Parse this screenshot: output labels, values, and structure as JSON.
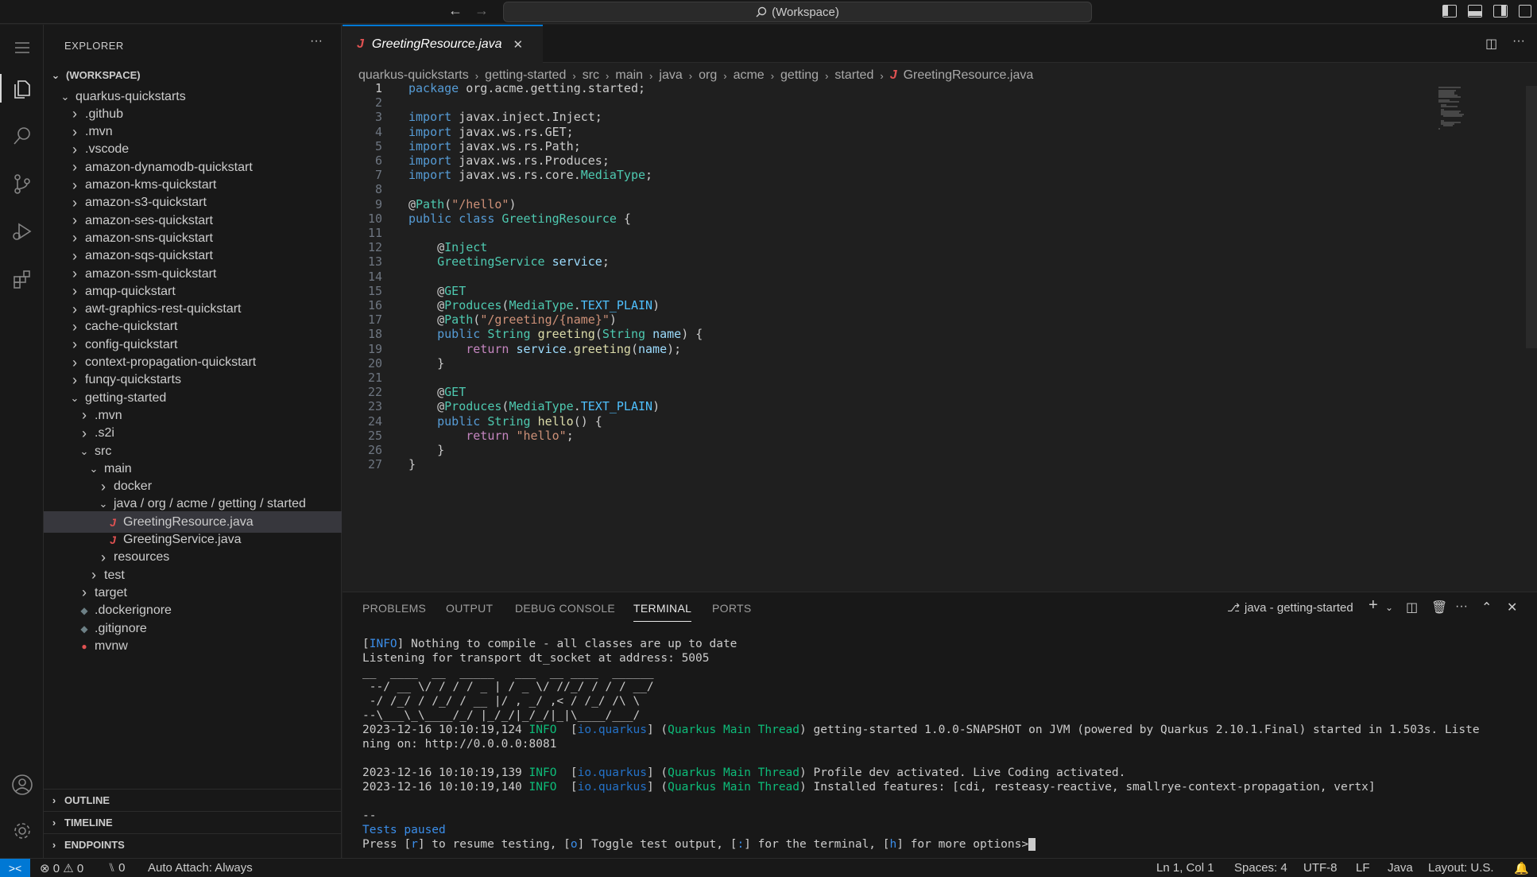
{
  "titlebar": {
    "search": "(Workspace)",
    "back_icon": "arrow-left-icon",
    "forward_icon": "arrow-right-icon"
  },
  "sidebar": {
    "title": "EXPLORER",
    "more": "···",
    "workspace": "(WORKSPACE)",
    "tree": [
      {
        "label": "quarkus-quickstarts",
        "depth": 1,
        "kind": "folder-open"
      },
      {
        "label": ".github",
        "depth": 2,
        "kind": "folder"
      },
      {
        "label": ".mvn",
        "depth": 2,
        "kind": "folder"
      },
      {
        "label": ".vscode",
        "depth": 2,
        "kind": "folder"
      },
      {
        "label": "amazon-dynamodb-quickstart",
        "depth": 2,
        "kind": "folder"
      },
      {
        "label": "amazon-kms-quickstart",
        "depth": 2,
        "kind": "folder"
      },
      {
        "label": "amazon-s3-quickstart",
        "depth": 2,
        "kind": "folder"
      },
      {
        "label": "amazon-ses-quickstart",
        "depth": 2,
        "kind": "folder"
      },
      {
        "label": "amazon-sns-quickstart",
        "depth": 2,
        "kind": "folder"
      },
      {
        "label": "amazon-sqs-quickstart",
        "depth": 2,
        "kind": "folder"
      },
      {
        "label": "amazon-ssm-quickstart",
        "depth": 2,
        "kind": "folder"
      },
      {
        "label": "amqp-quickstart",
        "depth": 2,
        "kind": "folder"
      },
      {
        "label": "awt-graphics-rest-quickstart",
        "depth": 2,
        "kind": "folder"
      },
      {
        "label": "cache-quickstart",
        "depth": 2,
        "kind": "folder"
      },
      {
        "label": "config-quickstart",
        "depth": 2,
        "kind": "folder"
      },
      {
        "label": "context-propagation-quickstart",
        "depth": 2,
        "kind": "folder"
      },
      {
        "label": "funqy-quickstarts",
        "depth": 2,
        "kind": "folder"
      },
      {
        "label": "getting-started",
        "depth": 2,
        "kind": "folder-open"
      },
      {
        "label": ".mvn",
        "depth": 3,
        "kind": "folder"
      },
      {
        "label": ".s2i",
        "depth": 3,
        "kind": "folder"
      },
      {
        "label": "src",
        "depth": 3,
        "kind": "folder-open"
      },
      {
        "label": "main",
        "depth": 4,
        "kind": "folder-open"
      },
      {
        "label": "docker",
        "depth": 5,
        "kind": "folder"
      },
      {
        "label": "java / org / acme / getting / started",
        "depth": 5,
        "kind": "folder-open"
      },
      {
        "label": "GreetingResource.java",
        "depth": 6,
        "kind": "java",
        "selected": true
      },
      {
        "label": "GreetingService.java",
        "depth": 6,
        "kind": "java"
      },
      {
        "label": "resources",
        "depth": 5,
        "kind": "folder"
      },
      {
        "label": "test",
        "depth": 4,
        "kind": "folder"
      },
      {
        "label": "target",
        "depth": 3,
        "kind": "folder"
      },
      {
        "label": ".dockerignore",
        "depth": 3,
        "kind": "dot"
      },
      {
        "label": ".gitignore",
        "depth": 3,
        "kind": "dot"
      },
      {
        "label": "mvnw",
        "depth": 3,
        "kind": "pin"
      }
    ],
    "sections": [
      "OUTLINE",
      "TIMELINE",
      "ENDPOINTS"
    ]
  },
  "editor": {
    "tab": {
      "label": "GreetingResource.java",
      "close": "✕"
    },
    "breadcrumb": [
      "quarkus-quickstarts",
      "getting-started",
      "src",
      "main",
      "java",
      "org",
      "acme",
      "getting",
      "started",
      "GreetingResource.java"
    ],
    "lines": [
      "package org.acme.getting.started;",
      "",
      "import javax.inject.Inject;",
      "import javax.ws.rs.GET;",
      "import javax.ws.rs.Path;",
      "import javax.ws.rs.Produces;",
      "import javax.ws.rs.core.MediaType;",
      "",
      "@Path(\"/hello\")",
      "public class GreetingResource {",
      "",
      "    @Inject",
      "    GreetingService service;",
      "",
      "    @GET",
      "    @Produces(MediaType.TEXT_PLAIN)",
      "    @Path(\"/greeting/{name}\")",
      "    public String greeting(String name) {",
      "        return service.greeting(name);",
      "    }",
      "",
      "    @GET",
      "    @Produces(MediaType.TEXT_PLAIN)",
      "    public String hello() {",
      "        return \"hello\";",
      "    }",
      "}"
    ]
  },
  "panel": {
    "tabs": [
      "PROBLEMS",
      "OUTPUT",
      "DEBUG CONSOLE",
      "TERMINAL",
      "PORTS"
    ],
    "active_tab": "TERMINAL",
    "terminal_name": "java - getting-started",
    "terminal": [
      "[INFO] Nothing to compile - all classes are up to date",
      "Listening for transport dt_socket at address: 5005",
      "__  ____  __  _____   ___  __ ____  ______ ",
      " --/ __ \\/ / / / _ | / _ \\/ //_/ / / / __/ ",
      " -/ /_/ / /_/ / __ |/ , _/ ,< / /_/ /\\ \\   ",
      "--\\___\\_\\____/_/ |_/_/|_/_/|_|\\____/___/   ",
      "2023-12-16 10:10:19,124 INFO  [io.quarkus] (Quarkus Main Thread) getting-started 1.0.0-SNAPSHOT on JVM (powered by Quarkus 2.10.1.Final) started in 1.503s. Liste",
      "ning on: http://0.0.0.0:8081",
      "",
      "2023-12-16 10:10:19,139 INFO  [io.quarkus] (Quarkus Main Thread) Profile dev activated. Live Coding activated.",
      "2023-12-16 10:10:19,140 INFO  [io.quarkus] (Quarkus Main Thread) Installed features: [cdi, resteasy-reactive, smallrye-context-propagation, vertx]",
      "",
      "--",
      "Tests paused",
      "Press [r] to resume testing, [o] Toggle test output, [:] for the terminal, [h] for more options>"
    ]
  },
  "statusbar": {
    "remote": "><",
    "problems": "⊗ 0 ⚠ 0",
    "ports": "⑊ 0",
    "auto_attach": "Auto Attach: Always",
    "position": "Ln 1, Col 1",
    "spaces": "Spaces: 4",
    "encoding": "UTF-8",
    "eol": "LF",
    "language": "Java",
    "layout": "Layout: U.S."
  },
  "colors": {
    "accent": "#0078d4",
    "background": "#1f1f1f",
    "sidebar": "#181818"
  }
}
